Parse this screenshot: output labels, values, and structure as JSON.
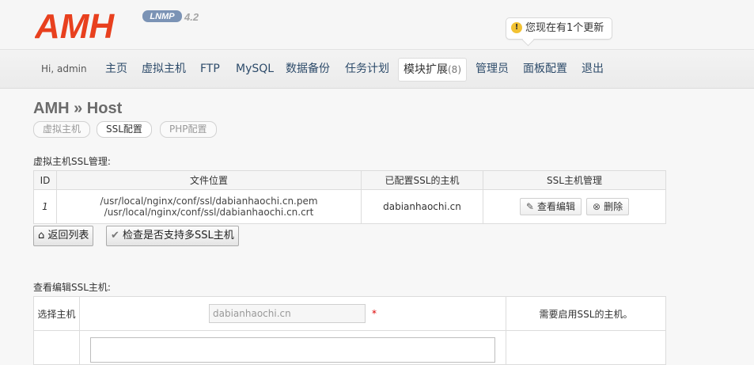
{
  "header": {
    "logo": {
      "text": "AMH",
      "badge": "LNMP",
      "version": "4.2"
    },
    "update_notice": "您现在有1个更新"
  },
  "nav": {
    "greeting": "Hi, admin",
    "items": [
      {
        "label": "主页"
      },
      {
        "label": "虚拟主机"
      },
      {
        "label": "FTP"
      },
      {
        "label": "MySQL"
      },
      {
        "label": "数据备份"
      },
      {
        "label": "任务计划"
      },
      {
        "label": "模块扩展",
        "count": "(8)",
        "active": true
      },
      {
        "label": "管理员"
      },
      {
        "label": "面板配置"
      },
      {
        "label": "退出"
      }
    ]
  },
  "page": {
    "title": "AMH » Host",
    "subtabs": [
      "虚拟主机",
      "SSL配置",
      "PHP配置"
    ]
  },
  "ssl_section": {
    "label": "虚拟主机SSL管理:",
    "columns": [
      "ID",
      "文件位置",
      "已配置SSL的主机",
      "SSL主机管理"
    ],
    "rows": [
      {
        "id": "1",
        "pem": "/usr/local/nginx/conf/ssl/dabianhaochi.cn.pem",
        "crt": "/usr/local/nginx/conf/ssl/dabianhaochi.cn.crt",
        "host": "dabianhaochi.cn",
        "view_edit": "查看编辑",
        "delete": "删除"
      }
    ],
    "back_button": "返回列表",
    "check_button": "检查是否支持多SSL主机"
  },
  "edit_section": {
    "label": "查看编辑SSL主机:",
    "select_host_label": "选择主机",
    "host_value": "dabianhaochi.cn",
    "required_mark": "*",
    "hint": "需要启用SSL的主机。"
  }
}
